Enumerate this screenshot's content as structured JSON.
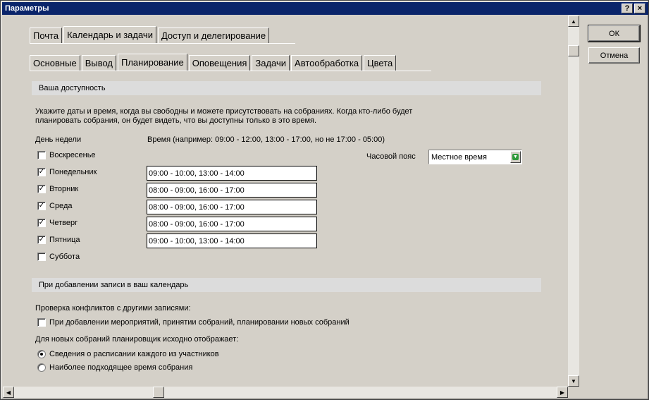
{
  "window": {
    "title": "Параметры",
    "help_label": "?",
    "close_label": "×"
  },
  "buttons": {
    "ok": "ОК",
    "cancel": "Отмена"
  },
  "main_tabs": [
    "Почта",
    "Календарь и задачи",
    "Доступ и делегирование"
  ],
  "sub_tabs": [
    "Основные",
    "Вывод",
    "Планирование",
    "Оповещения",
    "Задачи",
    "Автообработка",
    "Цвета"
  ],
  "availability": {
    "header": "Ваша доступность",
    "description_line1": "Укажите даты и время, когда вы свободны и можете присутствовать на собраниях. Когда кто-либо будет",
    "description_line2": "планировать собрания, он будет видеть, что вы доступны только в это время.",
    "day_col_label": "День недели",
    "time_col_label": "Время (например: 09:00 - 12:00, 13:00 - 17:00, но не 17:00 - 05:00)",
    "timezone_label": "Часовой пояс",
    "timezone_value": "Местное время",
    "days": [
      {
        "label": "Воскресенье",
        "checked": false,
        "time": ""
      },
      {
        "label": "Понедельник",
        "checked": true,
        "time": "09:00 - 10:00, 13:00 - 14:00"
      },
      {
        "label": "Вторник",
        "checked": true,
        "time": "08:00 - 09:00, 16:00 - 17:00"
      },
      {
        "label": "Среда",
        "checked": true,
        "time": "08:00 - 09:00, 16:00 - 17:00"
      },
      {
        "label": "Четверг",
        "checked": true,
        "time": "08:00 - 09:00, 16:00 - 17:00"
      },
      {
        "label": "Пятница",
        "checked": true,
        "time": "09:00 - 10:00, 13:00 - 14:00"
      },
      {
        "label": "Суббота",
        "checked": false,
        "time": ""
      }
    ]
  },
  "calendar_add": {
    "header": "При добавлении записи в ваш календарь",
    "conflicts_label": "Проверка конфликтов с другими записями:",
    "conflicts_checkbox": "При добавлении мероприятий, принятии собраний, планировании новых собраний",
    "planner_label": "Для новых собраний планировщик исходно отображает:",
    "radio_option1": "Сведения о расписании каждого из участников",
    "radio_option2": "Наиболее подходящее время собрания"
  },
  "icons": {
    "check": "✓",
    "scroll_up": "▲",
    "scroll_down": "▼",
    "scroll_left": "◀",
    "scroll_right": "▶"
  }
}
